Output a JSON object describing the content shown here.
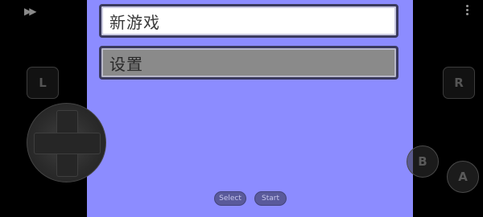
{
  "menu": {
    "new_game": "新游戏",
    "settings": "设置"
  },
  "controls": {
    "l_label": "L",
    "r_label": "R",
    "a_label": "A",
    "b_label": "B",
    "select_label": "Select",
    "start_label": "Start",
    "fast_forward_glyph": "▶▶",
    "overflow_icon": "more-vertical-icon",
    "dpad_icon": "dpad-icon"
  },
  "colors": {
    "game_background": "#8c8cff",
    "selected_item": "#ffffff",
    "unselected_item": "#8a8a8a",
    "overlay_background": "#000000"
  }
}
